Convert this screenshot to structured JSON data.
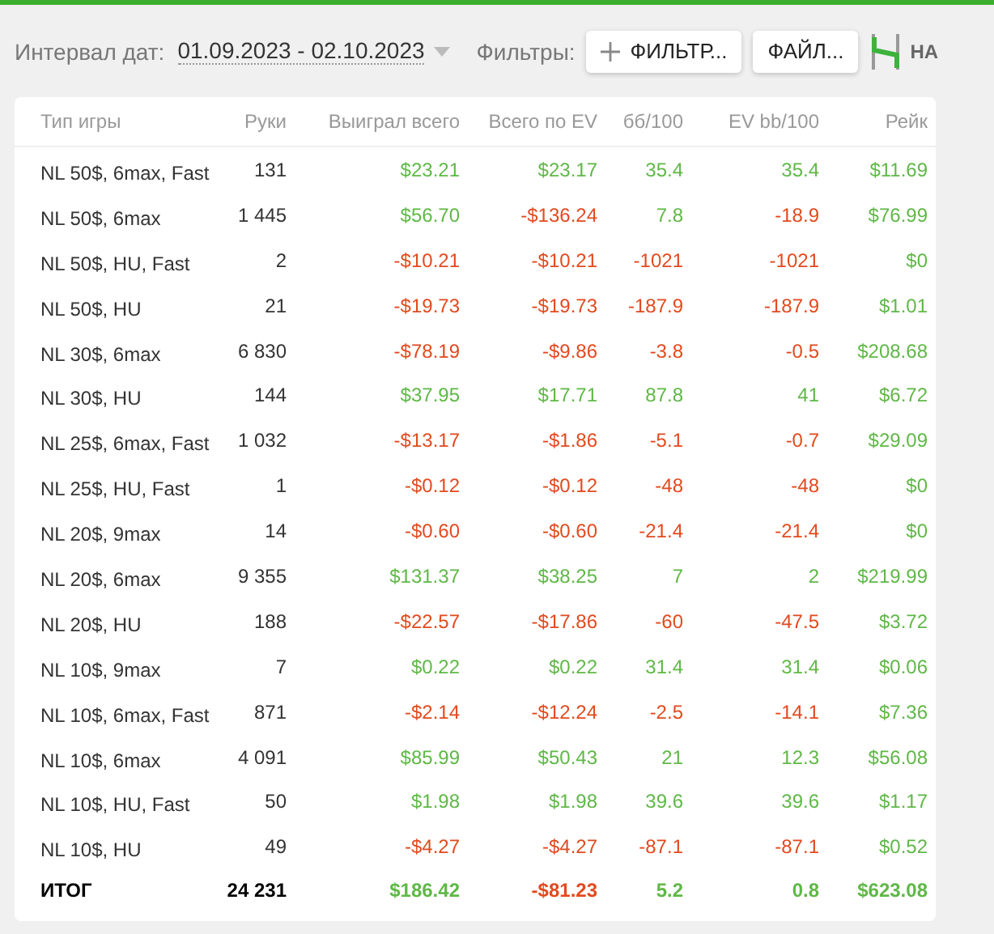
{
  "toolbar": {
    "date_label": "Интервал дат:",
    "date_range": "01.09.2023 - 02.10.2023",
    "filters_label": "Фильтры:",
    "filter_button": "ФИЛЬТР...",
    "file_button": "ФАЙЛ...",
    "logo_text": "HA"
  },
  "table": {
    "columns": [
      "Тип игры",
      "Руки",
      "Выиграл всего",
      "Всего по EV",
      "бб/100",
      "EV bb/100",
      "Рейк"
    ],
    "rows": [
      {
        "kind": "data",
        "cells": [
          {
            "text": "NL 50$, 6max, Fast"
          },
          {
            "text": "131"
          },
          {
            "text": "$23.21",
            "color": "#5fb847"
          },
          {
            "text": "$23.17",
            "color": "#5fb847"
          },
          {
            "text": "35.4",
            "color": "#5fb847"
          },
          {
            "text": "35.4",
            "color": "#5fb847"
          },
          {
            "text": "$11.69",
            "color": "#5fb847"
          }
        ]
      },
      {
        "kind": "data",
        "cells": [
          {
            "text": "NL 50$, 6max"
          },
          {
            "text": "1 445"
          },
          {
            "text": "$56.70",
            "color": "#5fb847"
          },
          {
            "text": "-$136.24",
            "color": "#e24a1f"
          },
          {
            "text": "7.8",
            "color": "#5fb847"
          },
          {
            "text": "-18.9",
            "color": "#e24a1f"
          },
          {
            "text": "$76.99",
            "color": "#5fb847"
          }
        ]
      },
      {
        "kind": "data",
        "cells": [
          {
            "text": "NL 50$, HU, Fast"
          },
          {
            "text": "2"
          },
          {
            "text": "-$10.21",
            "color": "#e24a1f"
          },
          {
            "text": "-$10.21",
            "color": "#e24a1f"
          },
          {
            "text": "-1021",
            "color": "#e24a1f"
          },
          {
            "text": "-1021",
            "color": "#e24a1f"
          },
          {
            "text": "$0",
            "color": "#5fb847"
          }
        ]
      },
      {
        "kind": "data",
        "cells": [
          {
            "text": "NL 50$, HU"
          },
          {
            "text": "21"
          },
          {
            "text": "-$19.73",
            "color": "#e24a1f"
          },
          {
            "text": "-$19.73",
            "color": "#e24a1f"
          },
          {
            "text": "-187.9",
            "color": "#e24a1f"
          },
          {
            "text": "-187.9",
            "color": "#e24a1f"
          },
          {
            "text": "$1.01",
            "color": "#5fb847"
          }
        ]
      },
      {
        "kind": "data",
        "cells": [
          {
            "text": "NL 30$, 6max"
          },
          {
            "text": "6 830"
          },
          {
            "text": "-$78.19",
            "color": "#e24a1f"
          },
          {
            "text": "-$9.86",
            "color": "#e24a1f"
          },
          {
            "text": "-3.8",
            "color": "#e24a1f"
          },
          {
            "text": "-0.5",
            "color": "#e24a1f"
          },
          {
            "text": "$208.68",
            "color": "#5fb847"
          }
        ]
      },
      {
        "kind": "data",
        "cells": [
          {
            "text": "NL 30$, HU"
          },
          {
            "text": "144"
          },
          {
            "text": "$37.95",
            "color": "#5fb847"
          },
          {
            "text": "$17.71",
            "color": "#5fb847"
          },
          {
            "text": "87.8",
            "color": "#5fb847"
          },
          {
            "text": "41",
            "color": "#5fb847"
          },
          {
            "text": "$6.72",
            "color": "#5fb847"
          }
        ]
      },
      {
        "kind": "data",
        "cells": [
          {
            "text": "NL 25$, 6max, Fast"
          },
          {
            "text": "1 032"
          },
          {
            "text": "-$13.17",
            "color": "#e24a1f"
          },
          {
            "text": "-$1.86",
            "color": "#e24a1f"
          },
          {
            "text": "-5.1",
            "color": "#e24a1f"
          },
          {
            "text": "-0.7",
            "color": "#e24a1f"
          },
          {
            "text": "$29.09",
            "color": "#5fb847"
          }
        ]
      },
      {
        "kind": "data",
        "cells": [
          {
            "text": "NL 25$, HU, Fast"
          },
          {
            "text": "1"
          },
          {
            "text": "-$0.12",
            "color": "#e24a1f"
          },
          {
            "text": "-$0.12",
            "color": "#e24a1f"
          },
          {
            "text": "-48",
            "color": "#e24a1f"
          },
          {
            "text": "-48",
            "color": "#e24a1f"
          },
          {
            "text": "$0",
            "color": "#5fb847"
          }
        ]
      },
      {
        "kind": "data",
        "cells": [
          {
            "text": "NL 20$, 9max"
          },
          {
            "text": "14"
          },
          {
            "text": "-$0.60",
            "color": "#e24a1f"
          },
          {
            "text": "-$0.60",
            "color": "#e24a1f"
          },
          {
            "text": "-21.4",
            "color": "#e24a1f"
          },
          {
            "text": "-21.4",
            "color": "#e24a1f"
          },
          {
            "text": "$0",
            "color": "#5fb847"
          }
        ]
      },
      {
        "kind": "data",
        "cells": [
          {
            "text": "NL 20$, 6max"
          },
          {
            "text": "9 355"
          },
          {
            "text": "$131.37",
            "color": "#5fb847"
          },
          {
            "text": "$38.25",
            "color": "#5fb847"
          },
          {
            "text": "7",
            "color": "#5fb847"
          },
          {
            "text": "2",
            "color": "#5fb847"
          },
          {
            "text": "$219.99",
            "color": "#5fb847"
          }
        ]
      },
      {
        "kind": "data",
        "cells": [
          {
            "text": "NL 20$, HU"
          },
          {
            "text": "188"
          },
          {
            "text": "-$22.57",
            "color": "#e24a1f"
          },
          {
            "text": "-$17.86",
            "color": "#e24a1f"
          },
          {
            "text": "-60",
            "color": "#e24a1f"
          },
          {
            "text": "-47.5",
            "color": "#e24a1f"
          },
          {
            "text": "$3.72",
            "color": "#5fb847"
          }
        ]
      },
      {
        "kind": "data",
        "cells": [
          {
            "text": "NL 10$, 9max"
          },
          {
            "text": "7"
          },
          {
            "text": "$0.22",
            "color": "#5fb847"
          },
          {
            "text": "$0.22",
            "color": "#5fb847"
          },
          {
            "text": "31.4",
            "color": "#5fb847"
          },
          {
            "text": "31.4",
            "color": "#5fb847"
          },
          {
            "text": "$0.06",
            "color": "#5fb847"
          }
        ]
      },
      {
        "kind": "data",
        "cells": [
          {
            "text": "NL 10$, 6max, Fast"
          },
          {
            "text": "871"
          },
          {
            "text": "-$2.14",
            "color": "#e24a1f"
          },
          {
            "text": "-$12.24",
            "color": "#e24a1f"
          },
          {
            "text": "-2.5",
            "color": "#e24a1f"
          },
          {
            "text": "-14.1",
            "color": "#e24a1f"
          },
          {
            "text": "$7.36",
            "color": "#5fb847"
          }
        ]
      },
      {
        "kind": "data",
        "cells": [
          {
            "text": "NL 10$, 6max"
          },
          {
            "text": "4 091"
          },
          {
            "text": "$85.99",
            "color": "#5fb847"
          },
          {
            "text": "$50.43",
            "color": "#5fb847"
          },
          {
            "text": "21",
            "color": "#5fb847"
          },
          {
            "text": "12.3",
            "color": "#5fb847"
          },
          {
            "text": "$56.08",
            "color": "#5fb847"
          }
        ]
      },
      {
        "kind": "data",
        "cells": [
          {
            "text": "NL 10$, HU, Fast"
          },
          {
            "text": "50"
          },
          {
            "text": "$1.98",
            "color": "#5fb847"
          },
          {
            "text": "$1.98",
            "color": "#5fb847"
          },
          {
            "text": "39.6",
            "color": "#5fb847"
          },
          {
            "text": "39.6",
            "color": "#5fb847"
          },
          {
            "text": "$1.17",
            "color": "#5fb847"
          }
        ]
      },
      {
        "kind": "data",
        "cells": [
          {
            "text": "NL 10$, HU"
          },
          {
            "text": "49"
          },
          {
            "text": "-$4.27",
            "color": "#e24a1f"
          },
          {
            "text": "-$4.27",
            "color": "#e24a1f"
          },
          {
            "text": "-87.1",
            "color": "#e24a1f"
          },
          {
            "text": "-87.1",
            "color": "#e24a1f"
          },
          {
            "text": "$0.52",
            "color": "#5fb847"
          }
        ]
      },
      {
        "kind": "total",
        "cells": [
          {
            "text": "ИТОГ"
          },
          {
            "text": "24 231"
          },
          {
            "text": "$186.42",
            "color": "#5fb847"
          },
          {
            "text": "-$81.23",
            "color": "#e24a1f"
          },
          {
            "text": "5.2",
            "color": "#5fb847"
          },
          {
            "text": "0.8",
            "color": "#5fb847"
          },
          {
            "text": "$623.08",
            "color": "#5fb847"
          }
        ]
      }
    ]
  }
}
